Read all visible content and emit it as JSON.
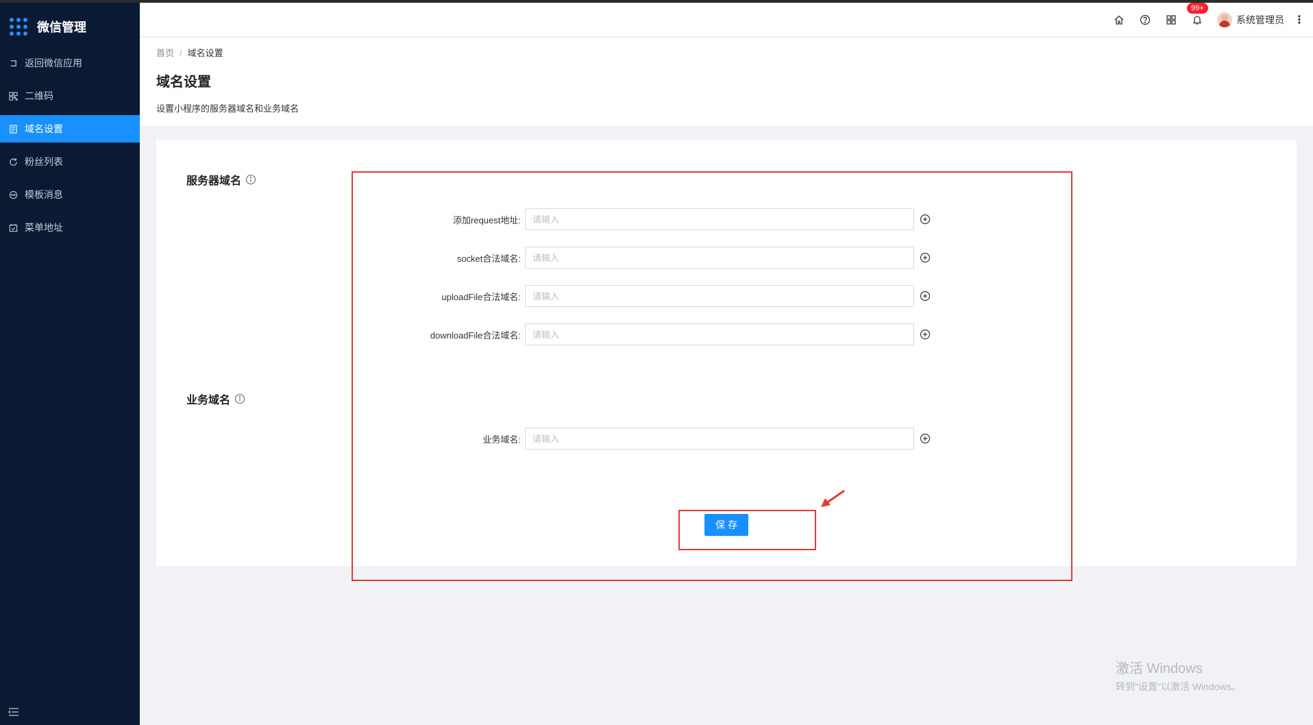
{
  "app": {
    "title": "微信管理"
  },
  "sidebar": {
    "items": [
      {
        "label": "返回微信应用",
        "icon": "return-icon"
      },
      {
        "label": "二维码",
        "icon": "qrcode-icon"
      },
      {
        "label": "域名设置",
        "icon": "document-icon",
        "active": true
      },
      {
        "label": "粉丝列表",
        "icon": "refresh-icon"
      },
      {
        "label": "模板消息",
        "icon": "message-icon"
      },
      {
        "label": "菜单地址",
        "icon": "calendar-check-icon"
      }
    ],
    "collapse_icon": "menu-collapse-icon"
  },
  "header": {
    "icons": [
      "home-icon",
      "help-icon",
      "grid-icon",
      "bell-icon"
    ],
    "badge": "99+",
    "username": "系统管理员",
    "more_icon": "more-vertical-icon"
  },
  "breadcrumb": {
    "home": "首页",
    "separator": "/",
    "current": "域名设置"
  },
  "page": {
    "title": "域名设置",
    "description": "设置小程序的服务器域名和业务域名"
  },
  "form": {
    "server_section_title": "服务器域名",
    "business_section_title": "业务域名",
    "fields": [
      {
        "label": "添加request地址:",
        "placeholder": "请输入",
        "value": ""
      },
      {
        "label": "socket合法域名:",
        "placeholder": "请输入",
        "value": ""
      },
      {
        "label": "uploadFile合法域名:",
        "placeholder": "请输入",
        "value": ""
      },
      {
        "label": "downloadFile合法域名:",
        "placeholder": "请输入",
        "value": ""
      }
    ],
    "business_field": {
      "label": "业务域名:",
      "placeholder": "请输入",
      "value": ""
    },
    "save_label": "保存"
  },
  "watermark": {
    "line1": "激活 Windows",
    "line2": "转到\"设置\"以激活 Windows。"
  },
  "colors": {
    "sidebar_bg": "#0a1a33",
    "accent": "#1890ff",
    "annotation": "#e53935",
    "badge": "#f5222d"
  }
}
